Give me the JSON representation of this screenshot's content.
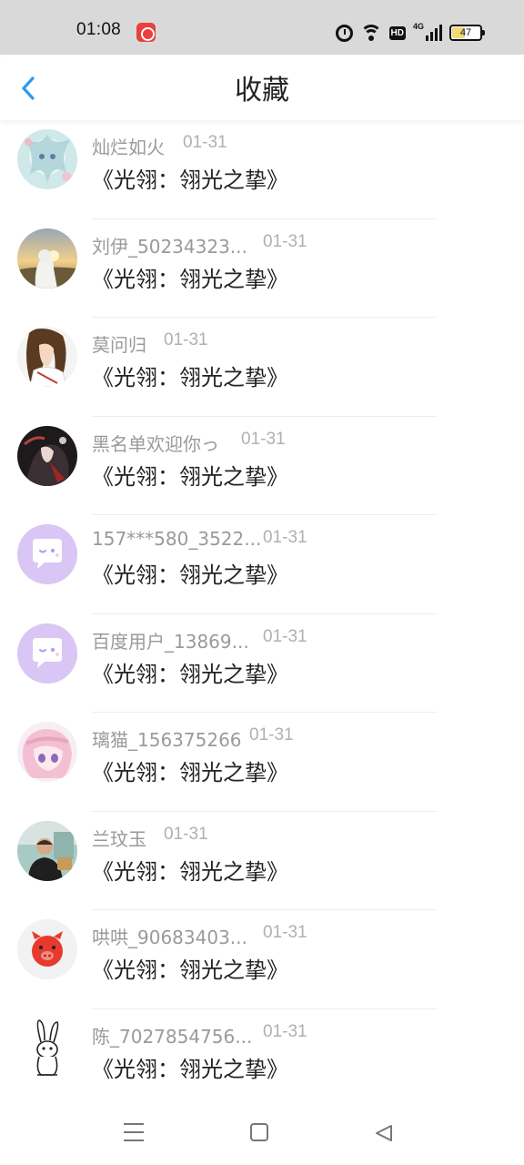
{
  "status_bar": {
    "time": "01:08",
    "hd": "HD",
    "network": "4G",
    "battery": "47",
    "battery_level_percent": 47,
    "battery_color": "#f3d977"
  },
  "header": {
    "title": "收藏",
    "back_icon": "chevron-left-icon",
    "accent": "#2a9af0"
  },
  "favorites": [
    {
      "user": "灿烂如火",
      "date": "01-31",
      "title": "《光翎：翎光之挚》",
      "avatar": "anime-art"
    },
    {
      "user": "刘伊_50234323...",
      "date": "01-31",
      "title": "《光翎：翎光之挚》",
      "avatar": "sunset-photo"
    },
    {
      "user": "莫问归",
      "date": "01-31",
      "title": "《光翎：翎光之挚》",
      "avatar": "anime-portrait"
    },
    {
      "user": "黑名单欢迎你っ",
      "date": "01-31",
      "title": "《光翎：翎光之挚》",
      "avatar": "dark-art"
    },
    {
      "user": "157***580_3522...",
      "date": "01-31",
      "title": "《光翎：翎光之挚》",
      "avatar": "default-chat-bubble"
    },
    {
      "user": "百度用户_13869...",
      "date": "01-31",
      "title": "《光翎：翎光之挚》",
      "avatar": "default-chat-bubble"
    },
    {
      "user": "璃猫_156375266",
      "date": "01-31",
      "title": "《光翎：翎光之挚》",
      "avatar": "pink-anime"
    },
    {
      "user": "兰玟玉",
      "date": "01-31",
      "title": "《光翎：翎光之挚》",
      "avatar": "person-photo"
    },
    {
      "user": "哄哄_90683403...",
      "date": "01-31",
      "title": "《光翎：翎光之挚》",
      "avatar": "red-pig-cartoon"
    },
    {
      "user": "陈_7027854756...",
      "date": "01-31",
      "title": "《光翎：翎光之挚》",
      "avatar": "rabbit-sketch"
    }
  ],
  "nav_bar": {
    "menu_icon": "menu-icon",
    "home_icon": "home-square-icon",
    "back_icon": "back-triangle-icon"
  }
}
